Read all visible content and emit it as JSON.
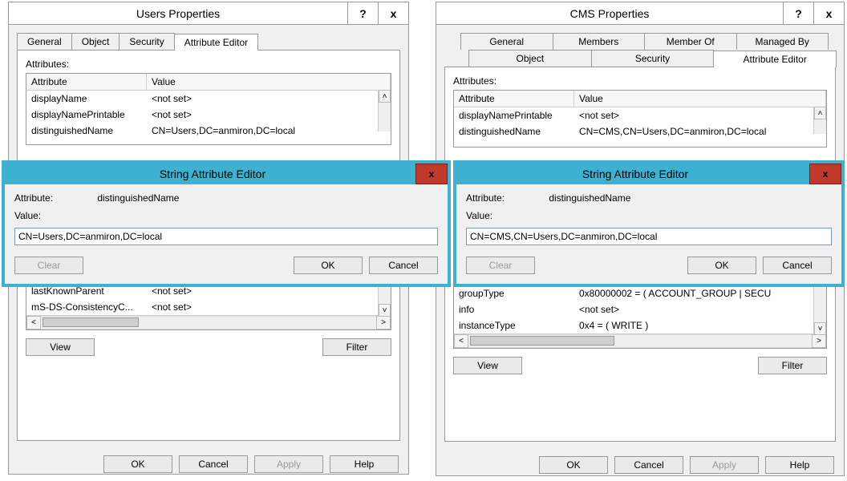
{
  "left": {
    "title": "Users Properties",
    "help": "?",
    "close": "x",
    "tabs": [
      "General",
      "Object",
      "Security",
      "Attribute Editor"
    ],
    "active_tab": 3,
    "attributes_label": "Attributes:",
    "col_attr": "Attribute",
    "col_val": "Value",
    "rows_top": [
      {
        "a": "displayName",
        "v": "<not set>"
      },
      {
        "a": "displayNamePrintable",
        "v": "<not set>"
      },
      {
        "a": "distinguishedName",
        "v": "CN=Users,DC=anmiron,DC=local"
      }
    ],
    "rows_bottom": [
      {
        "a": "lastKnownParent",
        "v": "<not set>"
      },
      {
        "a": "mS-DS-ConsistencyC...",
        "v": "<not set>"
      }
    ],
    "view_btn": "View",
    "filter_btn": "Filter",
    "ok": "OK",
    "cancel": "Cancel",
    "apply": "Apply",
    "help_btn": "Help"
  },
  "right": {
    "title": "CMS Properties",
    "help": "?",
    "close": "x",
    "tabs_row1": [
      "General",
      "Members",
      "Member Of",
      "Managed By"
    ],
    "tabs_row2": [
      "Object",
      "Security",
      "Attribute Editor"
    ],
    "active_tab": "Attribute Editor",
    "attributes_label": "Attributes:",
    "col_attr": "Attribute",
    "col_val": "Value",
    "rows_top": [
      {
        "a": "displayNamePrintable",
        "v": "<not set>"
      },
      {
        "a": "distinguishedName",
        "v": "CN=CMS,CN=Users,DC=anmiron,DC=local"
      }
    ],
    "rows_bottom": [
      {
        "a": "groupType",
        "v": "0x80000002 = ( ACCOUNT_GROUP | SECU"
      },
      {
        "a": "info",
        "v": "<not set>"
      },
      {
        "a": "instanceType",
        "v": "0x4 = ( WRITE )"
      }
    ],
    "view_btn": "View",
    "filter_btn": "Filter",
    "ok": "OK",
    "cancel": "Cancel",
    "apply": "Apply",
    "help_btn": "Help"
  },
  "modal_left": {
    "title": "String Attribute Editor",
    "attr_label_prefix": "Attribute:",
    "attr_name": "distinguishedName",
    "value_label": "Value:",
    "value": "CN=Users,DC=anmiron,DC=local",
    "clear": "Clear",
    "ok": "OK",
    "cancel": "Cancel",
    "close_x": "x"
  },
  "modal_right": {
    "title": "String Attribute Editor",
    "attr_label_prefix": "Attribute:",
    "attr_name": "distinguishedName",
    "value_label": "Value:",
    "value": "CN=CMS,CN=Users,DC=anmiron,DC=local",
    "clear": "Clear",
    "ok": "OK",
    "cancel": "Cancel",
    "close_x": "x"
  }
}
